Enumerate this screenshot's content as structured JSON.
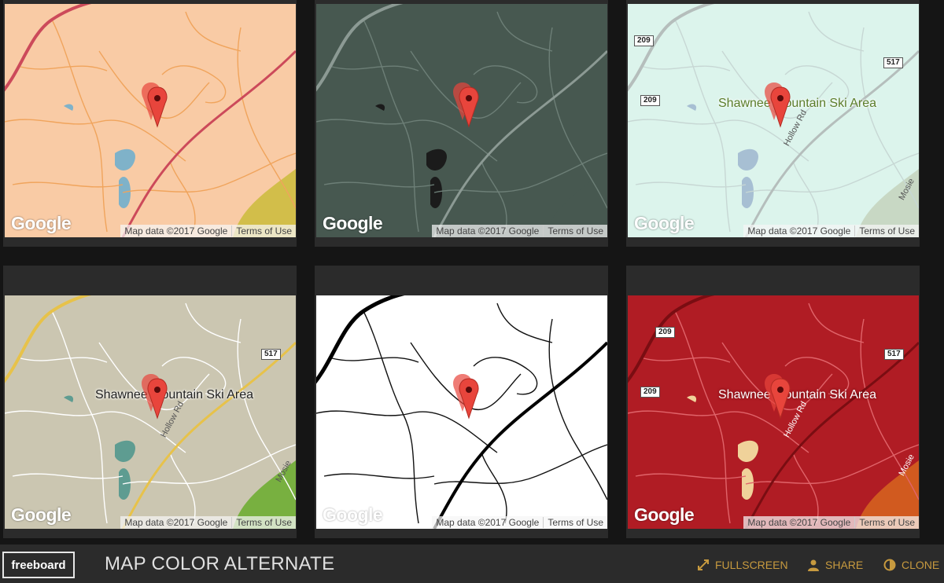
{
  "maps": [
    {
      "theme": "peach",
      "land": "#f9cba5",
      "road": "#f0a45c",
      "hwy": "#cc4a5a",
      "water": "#7fb2c9",
      "park": "#d2be4a",
      "logo": "Google",
      "map_data": "Map data ©2017 Google",
      "terms": "Terms of Use"
    },
    {
      "theme": "dark-slate",
      "land": "#475850",
      "road": "#6d7f77",
      "hwy": "#8c9a94",
      "water": "#1b1b1b",
      "park": "#475850",
      "logo": "Google",
      "map_data": "Map data ©2017 Google",
      "terms": "Terms of Use"
    },
    {
      "theme": "mint",
      "land": "#dcf4ec",
      "road": "#c7d7d4",
      "hwy": "#b5bebc",
      "water": "#a7bfd3",
      "park": "#c8d8c4",
      "logo": "Google",
      "map_data": "Map data ©2017 Google",
      "terms": "Terms of Use",
      "place": "Shawnee Mountain Ski Area",
      "road_label": "Hollow Rd",
      "road_label2": "Mosie",
      "shields": [
        "209",
        "209",
        "517"
      ]
    },
    {
      "theme": "khaki",
      "land": "#cbc6b1",
      "road": "#ffffff",
      "hwy": "#e7c24a",
      "water": "#5e9c91",
      "park": "#78b040",
      "logo": "Google",
      "map_data": "Map data ©2017 Google",
      "terms": "Terms of Use",
      "place": "Shawnee Mountain Ski Area",
      "road_label": "Hollow Rd",
      "road_label2": "Mosie",
      "shields": [
        "517"
      ]
    },
    {
      "theme": "black-white",
      "land": "#ffffff",
      "road": "#111111",
      "hwy": "#000000",
      "water": "#ffffff",
      "park": "#ffffff",
      "logo": "Google",
      "map_data": "Map data ©2017 Google",
      "terms": "Terms of Use"
    },
    {
      "theme": "crimson",
      "land": "#b01c24",
      "road": "#e0646a",
      "hwy": "#7a0d12",
      "water": "#f0d29a",
      "park": "#d15a1f",
      "logo": "Google",
      "map_data": "Map data ©2017 Google",
      "terms": "Terms of Use",
      "place": "Shawnee Mountain Ski Area",
      "road_label": "Hollow Rd",
      "road_label2": "Mosie",
      "shields": [
        "209",
        "209",
        "517"
      ]
    }
  ],
  "footer": {
    "brand": "freeboard",
    "title": "MAP COLOR ALTERNATE",
    "fullscreen": "FULLSCREEN",
    "share": "SHARE",
    "clone": "CLONE"
  },
  "colors": {
    "accent": "#c79a3f",
    "pin": "#e8453c",
    "background": "#151515",
    "panel": "#2b2b2b"
  }
}
